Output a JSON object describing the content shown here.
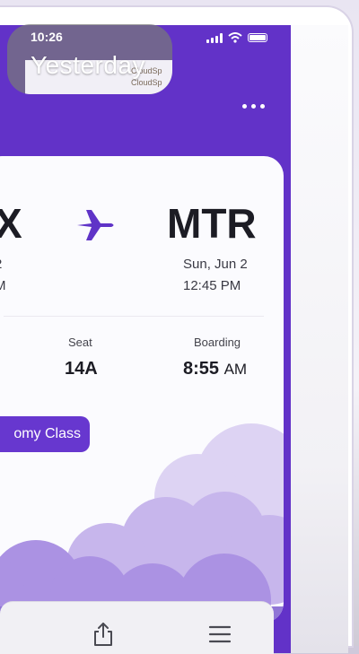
{
  "overlay": {
    "label": "Yesterday",
    "time": "10:26",
    "sub1": "CloudSp",
    "sub2": "CloudSp"
  },
  "status": {
    "time": "10:26"
  },
  "flight": {
    "from": {
      "code": "X",
      "date": "2",
      "time": "M"
    },
    "to": {
      "code": "MTR",
      "date": "Sun, Jun 2",
      "time": "12:45 PM"
    }
  },
  "details": {
    "seat_label": "Seat",
    "seat_value": "14A",
    "boarding_label": "Boarding",
    "boarding_value": "8:55",
    "boarding_ampm": "AM"
  },
  "class_chip": {
    "label": "omy Class"
  },
  "colors": {
    "brand": "#6232c8",
    "accent": "#6737cf",
    "card": "#fbfbfe"
  },
  "icons": {
    "back": "back-chevron-icon",
    "more": "more-dots-icon",
    "plane": "plane-icon",
    "share": "share-icon",
    "menu": "menu-icon"
  }
}
